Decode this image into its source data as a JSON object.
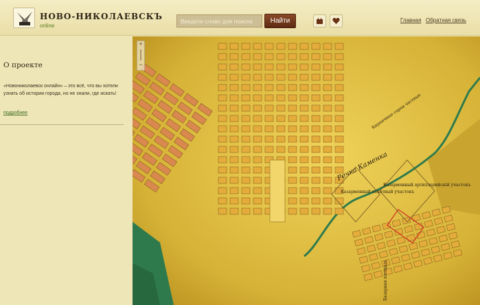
{
  "header": {
    "site_title": "НОВО-НИКОЛАЕВСКЪ",
    "site_subtitle": "online",
    "search": {
      "placeholder": "Введите слово для поиска",
      "button_label": "Найти"
    },
    "links": {
      "home": "Главная",
      "feedback": "Обратная связь"
    },
    "icons": {
      "castle": "castle-icon",
      "heart": "heart-icon"
    }
  },
  "sidebar": {
    "title": "О проекте",
    "text": "«Новониколаевск онлайн» – это всё, что вы хотели узнать об истории города, но не знали, где искать!",
    "more_link": "подробнее"
  },
  "map": {
    "labels": {
      "river": "Речка Каменка",
      "lot1": "Казарменный пехотный участокъ",
      "lot2": "Казарменный артиллерийскiй участокъ",
      "rail": "Кирпичные сараи частные",
      "square": "Базарная площадь"
    }
  },
  "colors": {
    "map_paper": "#d9b63a",
    "water": "#2e7a4d",
    "block_orange": "#d9894f",
    "block_yellow": "#e4ad3b",
    "header_bg": "#f1e8bd",
    "button_brown": "#6e3416"
  }
}
